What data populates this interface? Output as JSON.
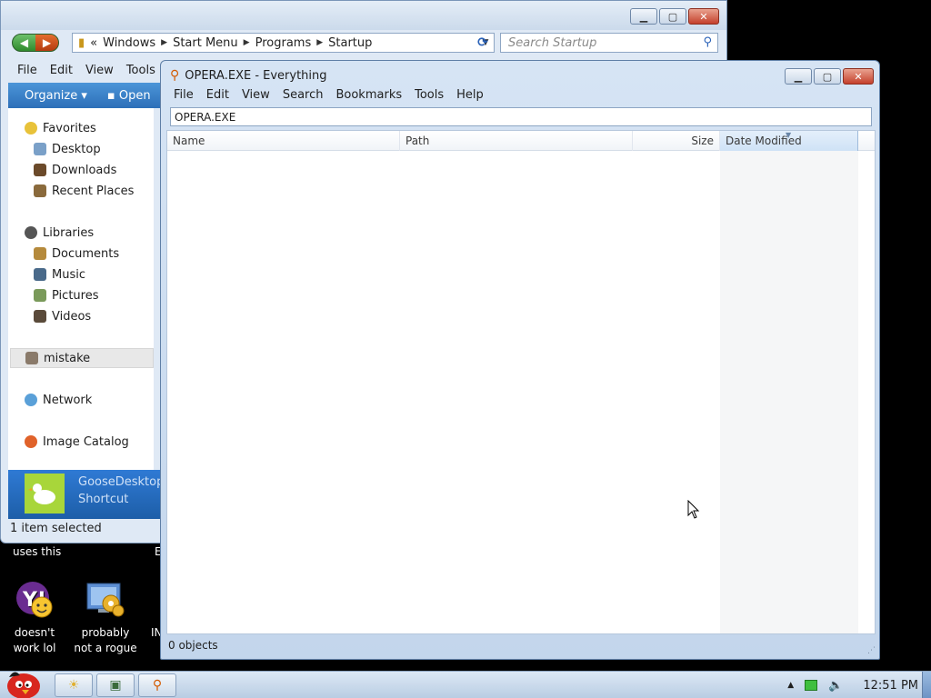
{
  "desktop": {
    "caption_top_left": "uses this",
    "caption_top_right": "E",
    "icons": [
      {
        "label": "doesn't work lol",
        "icon": "yahoo-messenger-icon"
      },
      {
        "label": "probably not a rogue",
        "icon": "monitor-gears-icon"
      },
      {
        "label": "IN",
        "icon": "partial-icon"
      }
    ]
  },
  "explorer": {
    "breadcrumb": {
      "overflow": "«",
      "parts": [
        "Windows",
        "Start Menu",
        "Programs",
        "Startup"
      ]
    },
    "search_placeholder": "Search Startup",
    "menu": [
      "File",
      "Edit",
      "View",
      "Tools"
    ],
    "command_bar": {
      "organize": "Organize ▾",
      "open": "Open"
    },
    "nav": {
      "favorites": "Favorites",
      "favorites_items": [
        "Desktop",
        "Downloads",
        "Recent Places"
      ],
      "libraries": "Libraries",
      "libraries_items": [
        "Documents",
        "Music",
        "Pictures",
        "Videos"
      ],
      "homegroup_user": "mistake",
      "network": "Network",
      "image_catalog": "Image Catalog"
    },
    "details": {
      "name": "GooseDesktop",
      "type": "Shortcut"
    },
    "status": "1 item selected",
    "colors": {
      "command_bar": "#2d6fb8",
      "details_pane": "#1d5ea8"
    }
  },
  "everything": {
    "title": "OPERA.EXE - Everything",
    "menu": [
      "File",
      "Edit",
      "View",
      "Search",
      "Bookmarks",
      "Tools",
      "Help"
    ],
    "search_value": "OPERA.EXE",
    "columns": {
      "name": "Name",
      "path": "Path",
      "size": "Size",
      "date_modified": "Date Modified"
    },
    "status": "0 objects"
  },
  "taskbar": {
    "buttons": [
      {
        "name": "explorer-task",
        "icon": "folder-icon"
      },
      {
        "name": "task-2",
        "icon": "app-icon"
      },
      {
        "name": "everything-task",
        "icon": "magnifier-icon"
      }
    ],
    "clock": "12:51 PM"
  }
}
